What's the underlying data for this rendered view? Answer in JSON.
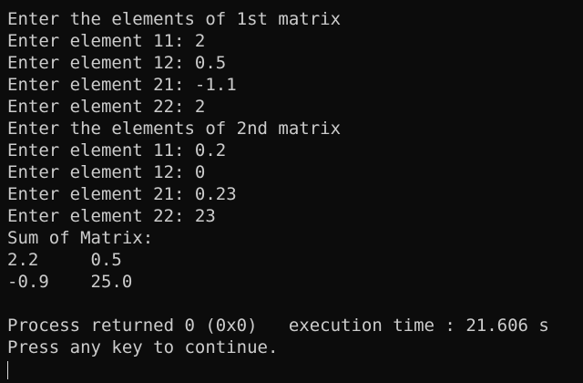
{
  "console": {
    "lines": [
      "Enter the elements of 1st matrix",
      "Enter element 11: 2",
      "Enter element 12: 0.5",
      "Enter element 21: -1.1",
      "Enter element 22: 2",
      "Enter the elements of 2nd matrix",
      "Enter element 11: 0.2",
      "Enter element 12: 0",
      "Enter element 21: 0.23",
      "Enter element 22: 23",
      "Sum of Matrix:",
      "2.2     0.5",
      "-0.9    25.0",
      "",
      "Process returned 0 (0x0)   execution time : 21.606 s",
      "Press any key to continue."
    ]
  },
  "colors": {
    "background": "#0c0c0c",
    "text": "#cccccc"
  }
}
